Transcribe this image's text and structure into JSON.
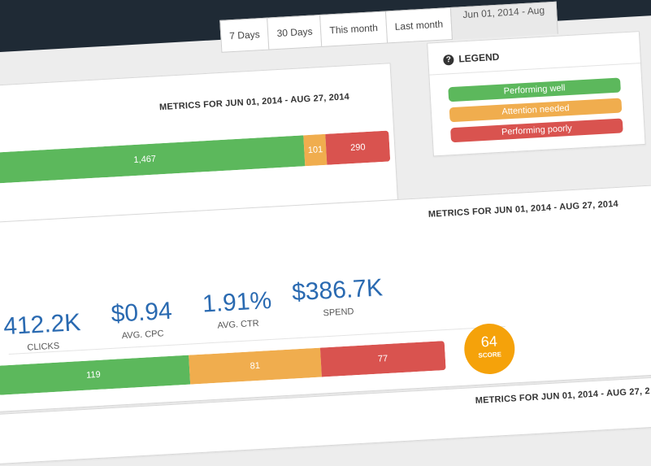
{
  "tabs": [
    "7 Days",
    "30 Days",
    "This month",
    "Last month",
    "Jun 01, 2014 - Aug"
  ],
  "legend": {
    "title": "LEGEND",
    "items": [
      {
        "label": "Performing well",
        "color": "#5cb85c"
      },
      {
        "label": "Attention needed",
        "color": "#f0ad4e"
      },
      {
        "label": "Performing poorly",
        "color": "#d9534f"
      }
    ]
  },
  "panel1": {
    "title": "METRICS FOR JUN 01, 2014 - AUG 27, 2014",
    "bar": {
      "good": 1467,
      "warn": 101,
      "bad": 290,
      "good_label": "1,467",
      "warn_label": "101",
      "bad_label": "290"
    }
  },
  "panel2": {
    "title": "METRICS FOR JUN 01, 2014 - AUG 27, 2014",
    "stats": [
      {
        "value": "412.2K",
        "label": "CLICKS"
      },
      {
        "value": "$0.94",
        "label": "AVG. CPC"
      },
      {
        "value": "1.91%",
        "label": "AVG. CTR"
      },
      {
        "value": "$386.7K",
        "label": "SPEND"
      }
    ],
    "bar": {
      "good": 119,
      "warn": 81,
      "bad": 77,
      "good_label": "119",
      "warn_label": "81",
      "bad_label": "77"
    },
    "score": {
      "value": "64",
      "label": "SCORE"
    }
  },
  "panel3": {
    "title": "METRICS FOR JUN 01, 2014 - AUG 27, 2"
  }
}
